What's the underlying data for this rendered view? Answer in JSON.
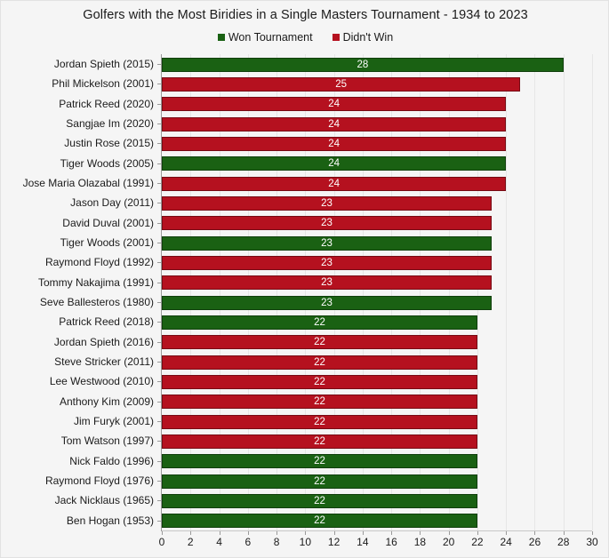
{
  "chart_data": {
    "type": "bar",
    "orientation": "horizontal",
    "title": "Golfers with the Most Biridies in a Single Masters Tournament - 1934 to 2023",
    "xlabel": "",
    "ylabel": "",
    "xlim": [
      0,
      30
    ],
    "xtick_step": 2,
    "grid": true,
    "legend_position": "top-center",
    "legend": [
      {
        "label": "Won Tournament",
        "color": "#1a6113",
        "key": "won"
      },
      {
        "label": "Didn't Win",
        "color": "#b5111f",
        "key": "lost"
      }
    ],
    "xticks": [
      "0",
      "2",
      "4",
      "6",
      "8",
      "10",
      "12",
      "14",
      "16",
      "18",
      "20",
      "22",
      "24",
      "26",
      "28",
      "30"
    ],
    "categories": [
      "Jordan Spieth (2015)",
      "Phil Mickelson (2001)",
      "Patrick Reed (2020)",
      "Sangjae Im (2020)",
      "Justin Rose (2015)",
      "Tiger Woods (2005)",
      "Jose Maria Olazabal (1991)",
      "Jason Day (2011)",
      "David Duval (2001)",
      "Tiger Woods (2001)",
      "Raymond Floyd (1992)",
      "Tommy Nakajima (1991)",
      "Seve Ballesteros (1980)",
      "Patrick Reed (2018)",
      "Jordan Spieth (2016)",
      "Steve Stricker (2011)",
      "Lee Westwood (2010)",
      "Anthony Kim (2009)",
      "Jim Furyk (2001)",
      "Tom Watson (1997)",
      "Nick Faldo (1996)",
      "Raymond Floyd (1976)",
      "Jack Nicklaus (1965)",
      "Ben Hogan (1953)"
    ],
    "values": [
      28,
      25,
      24,
      24,
      24,
      24,
      24,
      23,
      23,
      23,
      23,
      23,
      23,
      22,
      22,
      22,
      22,
      22,
      22,
      22,
      22,
      22,
      22,
      22
    ],
    "groups": [
      "won",
      "lost",
      "lost",
      "lost",
      "lost",
      "won",
      "lost",
      "lost",
      "lost",
      "won",
      "lost",
      "lost",
      "won",
      "won",
      "lost",
      "lost",
      "lost",
      "lost",
      "lost",
      "lost",
      "won",
      "won",
      "won",
      "won"
    ]
  },
  "colors": {
    "won": "#1a6113",
    "lost": "#b5111f",
    "background": "#f5f5f5",
    "grid": "#e6e6e6",
    "axis": "#9a9a9a",
    "text": "#1b1b1b",
    "bar_label": "#ffffff"
  }
}
